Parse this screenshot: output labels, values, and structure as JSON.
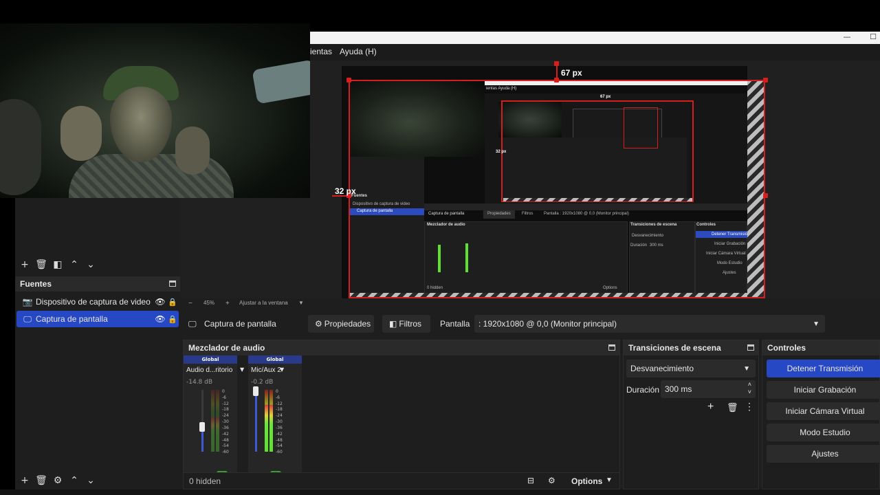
{
  "window": {
    "menu_partial": "ientas",
    "menu_help": "Ayuda (H)",
    "minimize_glyph": "—",
    "maximize_glyph": "☐"
  },
  "preview": {
    "dim_top": "67 px",
    "dim_left": "32 px",
    "nested_dim_top": "67 px",
    "nested_dim_left": "32 px",
    "nested_menu": "ientas   Ayuda (H)",
    "nested_sources_header": "Fuentes",
    "nested_source_1": "Dispositivo de captura de video",
    "nested_source_2": "Captura de pantalla",
    "nested_ctx": "Captura de pantalla",
    "nested_props": "Propiedades",
    "nested_filters": "Filtros",
    "nested_screen": "Pantalla   : 1920x1080 @ 0,0 (Monitor principal)",
    "nested_mixer": "Mezclador de audio",
    "nested_trans": "Transiciones de escena",
    "nested_controls": "Controles",
    "nested_fade": "Desvanecimiento",
    "nested_duration": "Duración",
    "nested_ms": "300 ms",
    "nested_btn1": "Detener Transmisión",
    "nested_btn2": "Iniciar Grabación",
    "nested_btn3": "Iniciar Cámara Virtual",
    "nested_btn4": "Modo Estudio",
    "nested_btn5": "Ajustes",
    "nested_hidden": "0 hidden",
    "nested_options": "Options"
  },
  "zoom": {
    "minus": "−",
    "value": "45%",
    "plus": "+",
    "fit_label": "Ajustar a la ventana"
  },
  "sources": {
    "header": "Fuentes",
    "items": [
      {
        "name": "Dispositivo de captura de video",
        "icon": "camera-icon",
        "selected": false
      },
      {
        "name": "Captura de pantalla",
        "icon": "monitor-icon",
        "selected": true
      }
    ]
  },
  "context": {
    "source_name": "Captura de pantalla",
    "properties_label": "Propiedades",
    "filters_label": "Filtros",
    "display_label": "Pantalla",
    "display_value": ": 1920x1080 @ 0,0 (Monitor principal)"
  },
  "mixer": {
    "header": "Mezclador de audio",
    "channels": [
      {
        "global": "Global",
        "name": "Audio d...ritorio",
        "db": "-14.8 dB",
        "fader": 0.4,
        "level": 0.55
      },
      {
        "global": "Global",
        "name": "Mic/Aux 2",
        "db": "-0.2 dB",
        "fader": 0.98,
        "level": 0.75
      }
    ],
    "scale": [
      "0",
      "-6",
      "-12",
      "-18",
      "-24",
      "-30",
      "-36",
      "-42",
      "-48",
      "-54",
      "-60"
    ],
    "hidden_label": "0 hidden",
    "options_label": "Options"
  },
  "transitions": {
    "header": "Transiciones de escena",
    "selected": "Desvanecimiento",
    "duration_label": "Duración",
    "duration_value": "300 ms"
  },
  "controls": {
    "header": "Controles",
    "buttons": [
      "Detener Transmisión",
      "Iniciar Grabación",
      "Iniciar Cámara Virtual",
      "Modo Estudio",
      "Ajustes"
    ]
  },
  "colors": {
    "accent": "#2748c4",
    "selection_red": "#d51f1f",
    "meter_green": "#5fe02f"
  }
}
